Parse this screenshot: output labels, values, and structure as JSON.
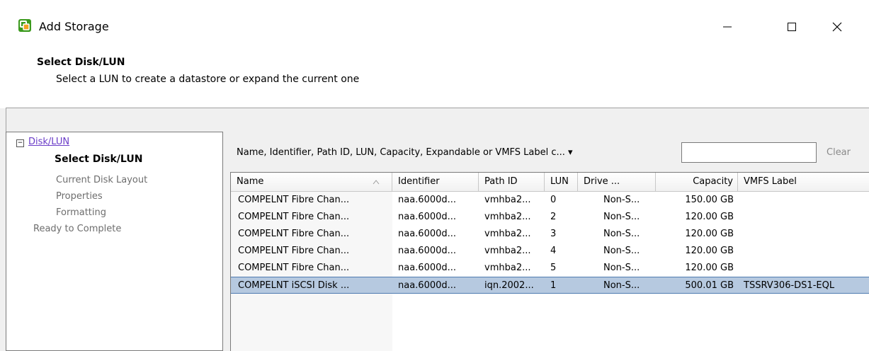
{
  "window": {
    "title": "Add Storage",
    "controls": {
      "minimize": "—",
      "maximize": "☐",
      "close": "✕"
    }
  },
  "header": {
    "title": "Select Disk/LUN",
    "subtitle": "Select a LUN to create a datastore or expand the current one"
  },
  "nav": {
    "expander": "−",
    "items": [
      {
        "label": "Disk/LUN",
        "style": "link"
      },
      {
        "label": "Select Disk/LUN",
        "style": "bold"
      },
      {
        "label": "Current Disk Layout",
        "style": "gray"
      },
      {
        "label": "Properties",
        "style": "gray"
      },
      {
        "label": "Formatting",
        "style": "gray"
      },
      {
        "label": "Ready to Complete",
        "style": "gray"
      }
    ]
  },
  "filter": {
    "label": "Name, Identifier, Path ID, LUN, Capacity, Expandable or VMFS Label c... ▾",
    "value": "",
    "clear_label": "Clear"
  },
  "table": {
    "columns": [
      "Name",
      "Identifier",
      "Path ID",
      "LUN",
      "Drive ...",
      "Capacity",
      "VMFS Label"
    ],
    "rows": [
      [
        "COMPELNT Fibre Chan...",
        "naa.6000d...",
        "vmhba2...",
        "0",
        "Non-S...",
        "150.00 GB",
        ""
      ],
      [
        "COMPELNT Fibre Chan...",
        "naa.6000d...",
        "vmhba2...",
        "2",
        "Non-S...",
        "120.00 GB",
        ""
      ],
      [
        "COMPELNT Fibre Chan...",
        "naa.6000d...",
        "vmhba2...",
        "3",
        "Non-S...",
        "120.00 GB",
        ""
      ],
      [
        "COMPELNT Fibre Chan...",
        "naa.6000d...",
        "vmhba2...",
        "4",
        "Non-S...",
        "120.00 GB",
        ""
      ],
      [
        "COMPELNT Fibre Chan...",
        "naa.6000d...",
        "vmhba2...",
        "5",
        "Non-S...",
        "120.00 GB",
        ""
      ],
      [
        "COMPELNT iSCSI Disk ...",
        "naa.6000d...",
        "iqn.2002...",
        "1",
        "Non-S...",
        "500.01 GB",
        "TSSRV306-DS1-EQL"
      ]
    ],
    "selected_row": 5
  },
  "colors": {
    "selection": "#b6c9e0",
    "link": "#6a3cc8",
    "app_icon_green": "#3c9a1e",
    "app_icon_orange": "#f0a020"
  }
}
